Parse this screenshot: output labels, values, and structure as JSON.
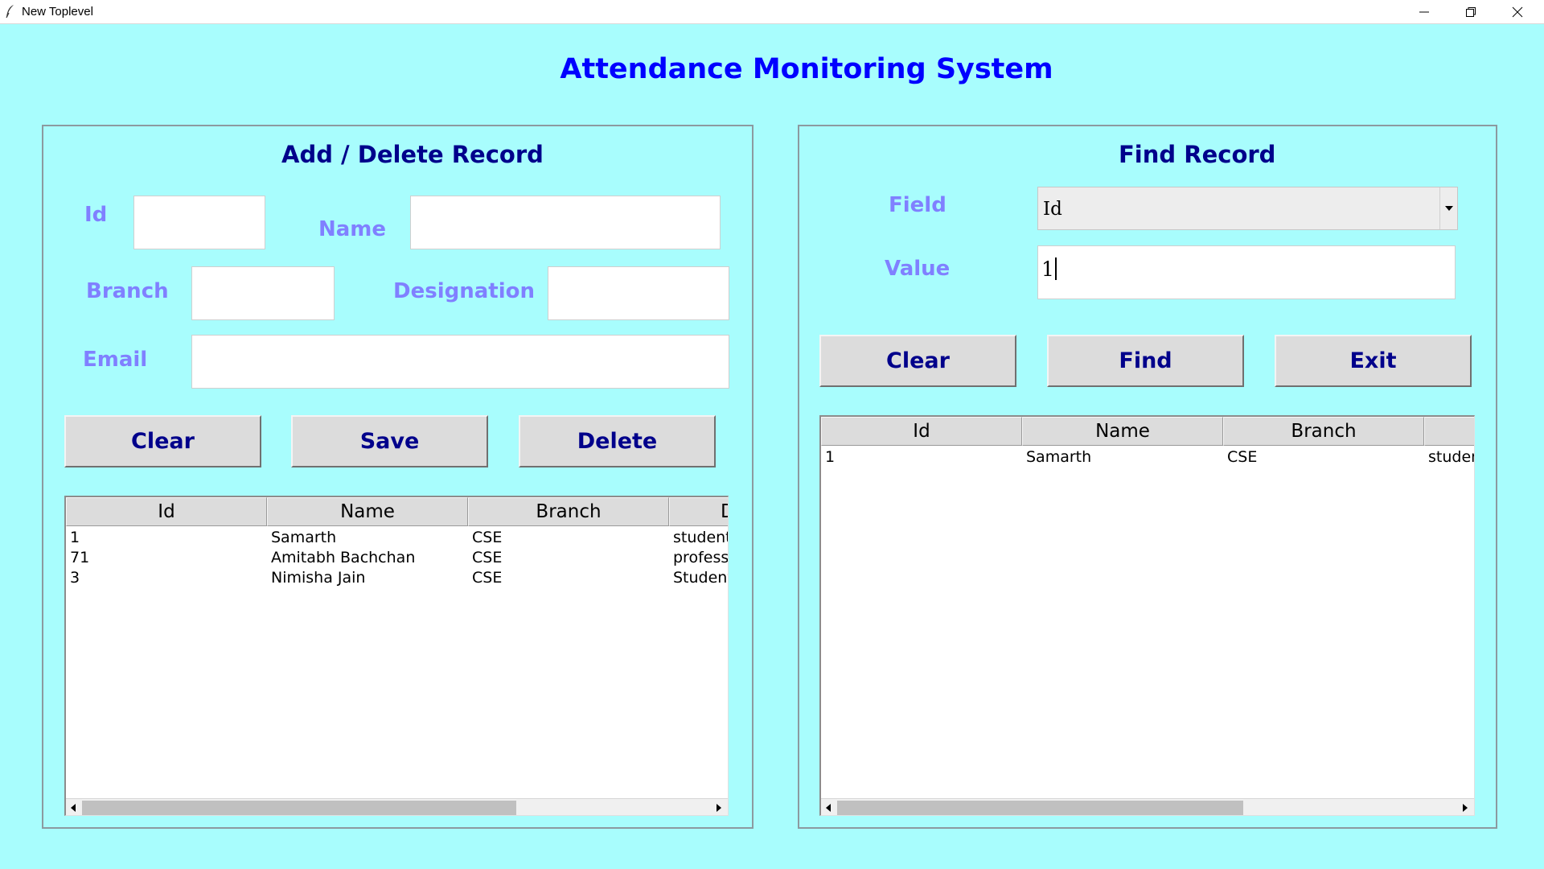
{
  "window": {
    "title": "New Toplevel"
  },
  "app": {
    "title": "Attendance Monitoring System"
  },
  "add_panel": {
    "title": "Add / Delete Record",
    "labels": {
      "id": "Id",
      "name": "Name",
      "branch": "Branch",
      "designation": "Designation",
      "email": "Email"
    },
    "values": {
      "id": "",
      "name": "",
      "branch": "",
      "designation": "",
      "email": ""
    },
    "buttons": {
      "clear": "Clear",
      "save": "Save",
      "delete": "Delete"
    },
    "table": {
      "columns": [
        "Id",
        "Name",
        "Branch",
        "D"
      ],
      "rows": [
        [
          "1",
          "Samarth",
          "CSE",
          "student"
        ],
        [
          "71",
          "Amitabh Bachchan",
          "CSE",
          "profess"
        ],
        [
          "3",
          "Nimisha Jain",
          "CSE",
          "Student"
        ]
      ]
    }
  },
  "find_panel": {
    "title": "Find Record",
    "labels": {
      "field": "Field",
      "value": "Value"
    },
    "field_selected": "Id",
    "value_input": "1",
    "buttons": {
      "clear": "Clear",
      "find": "Find",
      "exit": "Exit"
    },
    "table": {
      "columns": [
        "Id",
        "Name",
        "Branch",
        ""
      ],
      "rows": [
        [
          "1",
          "Samarth",
          "CSE",
          "studen"
        ]
      ]
    }
  },
  "icons": {
    "app_icon": "feather-icon",
    "minimize": "minimize-icon",
    "maximize": "restore-icon",
    "close": "close-icon"
  },
  "colors": {
    "background": "#a8fdfd",
    "app_title": "#0000ff",
    "panel_title": "#00008b",
    "label": "#8080ff",
    "button_text": "#00008b"
  }
}
